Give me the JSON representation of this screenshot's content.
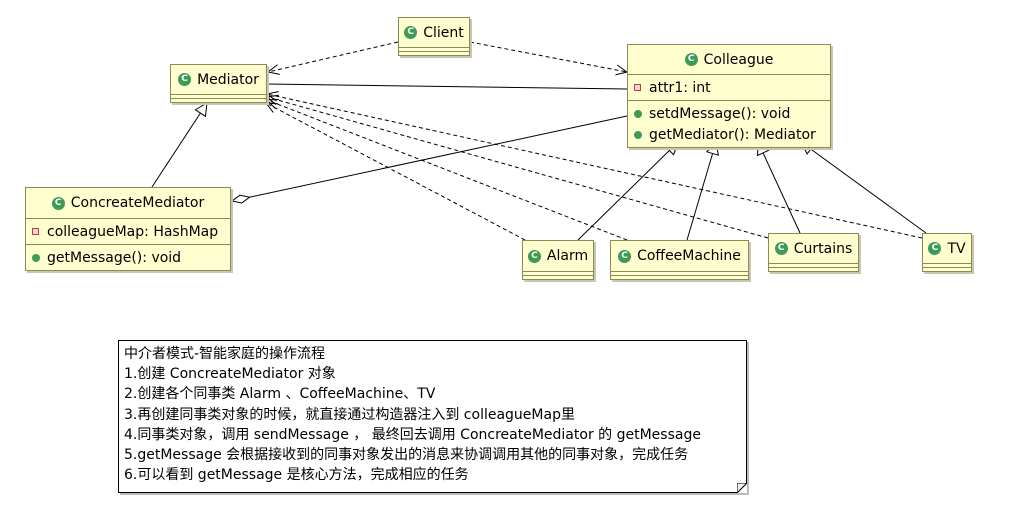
{
  "diagram": {
    "classes": {
      "client": {
        "name": "Client"
      },
      "mediator": {
        "name": "Mediator"
      },
      "colleague": {
        "name": "Colleague",
        "attributes": [
          "attr1: int"
        ],
        "operations": [
          "setdMessage(): void",
          "getMediator(): Mediator"
        ]
      },
      "concreate_mediator": {
        "name": "ConcreateMediator",
        "attributes": [
          "colleagueMap: HashMap"
        ],
        "operations": [
          "getMessage(): void"
        ]
      },
      "alarm": {
        "name": "Alarm"
      },
      "coffee_machine": {
        "name": "CoffeeMachine"
      },
      "curtains": {
        "name": "Curtains"
      },
      "tv": {
        "name": "TV"
      }
    },
    "class_icon_letter": "C",
    "note": {
      "lines": [
        "中介者模式-智能家庭的操作流程",
        "1.创建 ConcreateMediator 对象",
        "2.创建各个同事类 Alarm 、CoffeeMachine、TV",
        "3.再创建同事类对象的时候，就直接通过构造器注入到 colleagueMap里",
        "4.同事类对象，调用 sendMessage ， 最终回去调用 ConcreateMediator 的 getMessage",
        "5.getMessage 会根据接收到的同事对象发出的消息来协调调用其他的同事对象，完成任务",
        "6.可以看到 getMessage 是核心方法，完成相应的任务"
      ]
    },
    "colors": {
      "class_fill": "#fefecf",
      "class_border": "#8a8a57",
      "class_icon": "#3e9a57",
      "private_attr_icon": "#c23a3a",
      "public_op_icon": "#3f9a54"
    }
  }
}
